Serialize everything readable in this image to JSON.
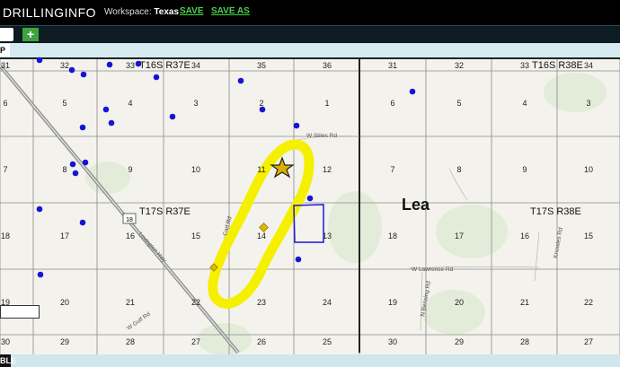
{
  "app": {
    "logo": "DRILLINGINFO",
    "workspace_label": "Workspace: ",
    "workspace_name": "Texas",
    "save_label": "SAVE",
    "save_as_label": "SAVE AS"
  },
  "tabs": {
    "add_label": "+"
  },
  "side": {
    "top_button_label": "P",
    "bottom_button_label": "BLE"
  },
  "map": {
    "township_labels": [
      {
        "text": "T16S R37E"
      },
      {
        "text": "T16S R38E"
      },
      {
        "text": "T17S R37E"
      },
      {
        "text": "T17S R38E"
      }
    ],
    "county_label": "Lea",
    "road_labels": [
      "W Stiles Rd",
      "Lovington Hwy",
      "W Lawrence Rd",
      "W Gulf Rd",
      "N Bensing Rd",
      "Knowles Rd",
      "Carl Rd"
    ],
    "highway_shield": "18",
    "section_numbers": [
      "31",
      "32",
      "33",
      "34",
      "35",
      "36",
      "31",
      "32",
      "33",
      "34",
      "6",
      "5",
      "4",
      "3",
      "2",
      "1",
      "6",
      "5",
      "4",
      "3",
      "7",
      "8",
      "9",
      "10",
      "11",
      "12",
      "7",
      "8",
      "9",
      "10",
      "18",
      "17",
      "16",
      "15",
      "14",
      "13",
      "18",
      "17",
      "16",
      "15",
      "19",
      "20",
      "21",
      "22",
      "23",
      "24",
      "19",
      "20",
      "21",
      "22",
      "30",
      "29",
      "28",
      "27",
      "26",
      "25",
      "30",
      "29",
      "28",
      "27"
    ],
    "colors": {
      "well_dot": "#1515d6",
      "highlight": "#f5f000",
      "lease_outline": "#1a1ad0",
      "diamond": "#e0b800",
      "map_bg": "#f6f4ee"
    },
    "icons": [
      "well-dot-icon",
      "star-marker-icon",
      "diamond-marker-icon",
      "highway-shield-icon"
    ]
  }
}
